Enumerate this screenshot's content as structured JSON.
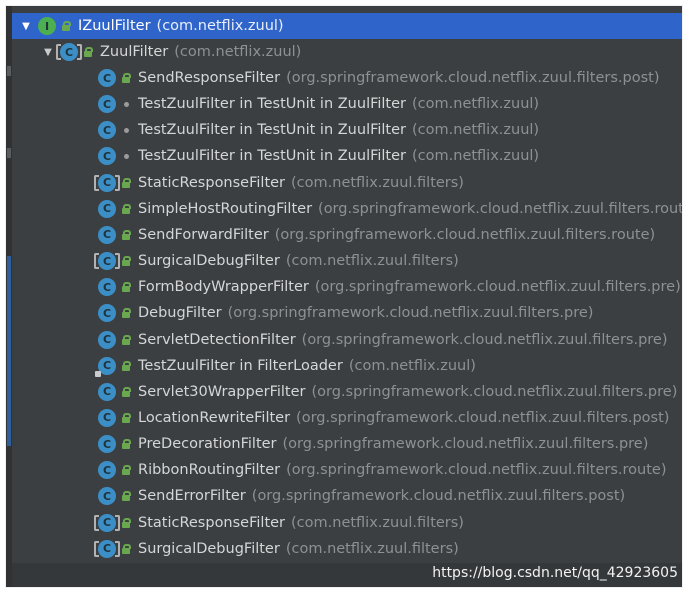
{
  "tree": {
    "root": {
      "label": "IZuulFilter",
      "package": "(com.netflix.zuul)",
      "icon": "interface-icon",
      "expanded_icon": "expand-arrow-icon",
      "selected": true
    },
    "child": {
      "label": "ZuulFilter",
      "package": "(com.netflix.zuul)",
      "icon": "abstract-class-icon",
      "expanded_icon": "expand-arrow-icon"
    },
    "items": [
      {
        "label": "SendResponseFilter",
        "package": "(org.springframework.cloud.netflix.zuul.filters.post)",
        "icon": "class",
        "visibility": "lock"
      },
      {
        "label": "TestZuulFilter in TestUnit in ZuulFilter",
        "package": "(com.netflix.zuul)",
        "icon": "class",
        "visibility": "dot"
      },
      {
        "label": "TestZuulFilter in TestUnit in ZuulFilter",
        "package": "(com.netflix.zuul)",
        "icon": "class",
        "visibility": "dot"
      },
      {
        "label": "TestZuulFilter in TestUnit in ZuulFilter",
        "package": "(com.netflix.zuul)",
        "icon": "class",
        "visibility": "dot"
      },
      {
        "label": "StaticResponseFilter",
        "package": "(com.netflix.zuul.filters)",
        "icon": "class-bracket",
        "visibility": "lock"
      },
      {
        "label": "SimpleHostRoutingFilter",
        "package": "(org.springframework.cloud.netflix.zuul.filters.route",
        "icon": "class",
        "visibility": "lock"
      },
      {
        "label": "SendForwardFilter",
        "package": "(org.springframework.cloud.netflix.zuul.filters.route)",
        "icon": "class",
        "visibility": "lock"
      },
      {
        "label": "SurgicalDebugFilter",
        "package": "(com.netflix.zuul.filters)",
        "icon": "class-bracket",
        "visibility": "lock"
      },
      {
        "label": "FormBodyWrapperFilter",
        "package": "(org.springframework.cloud.netflix.zuul.filters.pre)",
        "icon": "class",
        "visibility": "lock"
      },
      {
        "label": "DebugFilter",
        "package": "(org.springframework.cloud.netflix.zuul.filters.pre)",
        "icon": "class",
        "visibility": "lock"
      },
      {
        "label": "ServletDetectionFilter",
        "package": "(org.springframework.cloud.netflix.zuul.filters.pre)",
        "icon": "class",
        "visibility": "lock"
      },
      {
        "label": "TestZuulFilter in FilterLoader",
        "package": "(com.netflix.zuul)",
        "icon": "class-plus",
        "visibility": "lock"
      },
      {
        "label": "Servlet30WrapperFilter",
        "package": "(org.springframework.cloud.netflix.zuul.filters.pre)",
        "icon": "class",
        "visibility": "lock"
      },
      {
        "label": "LocationRewriteFilter",
        "package": "(org.springframework.cloud.netflix.zuul.filters.post)",
        "icon": "class",
        "visibility": "lock"
      },
      {
        "label": "PreDecorationFilter",
        "package": "(org.springframework.cloud.netflix.zuul.filters.pre)",
        "icon": "class",
        "visibility": "lock"
      },
      {
        "label": "RibbonRoutingFilter",
        "package": "(org.springframework.cloud.netflix.zuul.filters.route)",
        "icon": "class",
        "visibility": "lock"
      },
      {
        "label": "SendErrorFilter",
        "package": "(org.springframework.cloud.netflix.zuul.filters.post)",
        "icon": "class",
        "visibility": "lock"
      },
      {
        "label": "StaticResponseFilter",
        "package": "(com.netflix.zuul.filters)",
        "icon": "class-bracket",
        "visibility": "lock"
      },
      {
        "label": "SurgicalDebugFilter",
        "package": "(com.netflix.zuul.filters)",
        "icon": "class-bracket",
        "visibility": "lock"
      }
    ]
  },
  "watermark": "https://blog.csdn.net/qq_42923605",
  "colors": {
    "panel_bg": "#3c3f41",
    "selection": "#2f65ca",
    "class_icon": "#3b8fc6",
    "interface_icon": "#4caf50",
    "lock": "#6aa84f",
    "package_text": "#8e9194"
  }
}
